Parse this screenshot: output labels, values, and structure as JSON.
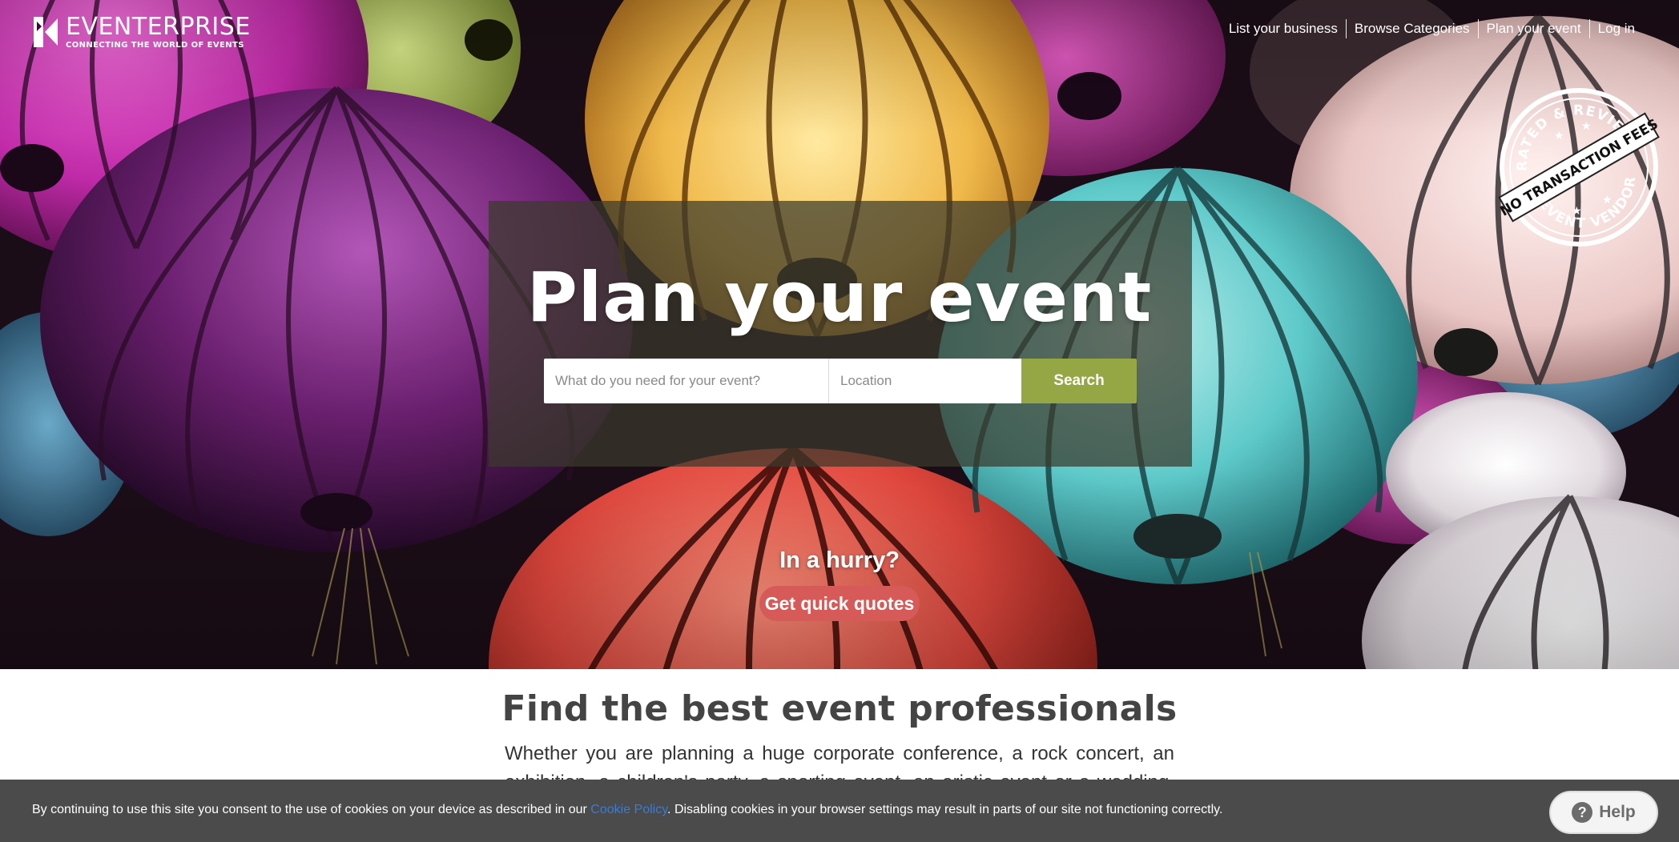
{
  "brand": {
    "name": "EVENTERPRISE",
    "tagline": "CONNECTING THE WORLD OF EVENTS"
  },
  "nav": {
    "items": [
      {
        "label": "List your business"
      },
      {
        "label": "Browse Categories"
      },
      {
        "label": "Plan your event"
      },
      {
        "label": "Log in"
      }
    ]
  },
  "badge": {
    "top_text": "RATED & REVIEWED",
    "band_text": "NO TRANSACTION FEES",
    "bottom_text": "EVENT VENDORS"
  },
  "hero": {
    "title": "Plan your event",
    "search": {
      "what_placeholder": "What do you need for your event?",
      "what_value": "",
      "location_placeholder": "Location",
      "location_value": "",
      "button_label": "Search"
    },
    "hurry_text": "In a hurry?",
    "quotes_button": "Get quick quotes"
  },
  "intro": {
    "title": "Find the best event professionals",
    "text": "Whether you are planning a huge corporate conference, a rock concert, an exhibition, a children's party, a sporting event, an aristic event or a wedding, our"
  },
  "cookie": {
    "text_before": "By continuing to use this site you consent to the use of cookies on your device as described in our ",
    "link_label": "Cookie Policy",
    "text_after": ". Disabling cookies in your browser settings may result in parts of our site not functioning correctly."
  },
  "help": {
    "label": "Help",
    "icon": "question-icon"
  },
  "colors": {
    "search_button": "#95a744",
    "quotes_button": "#d65a58",
    "cookie_bar": "#4b4b4b",
    "link": "#3a7bd5"
  }
}
